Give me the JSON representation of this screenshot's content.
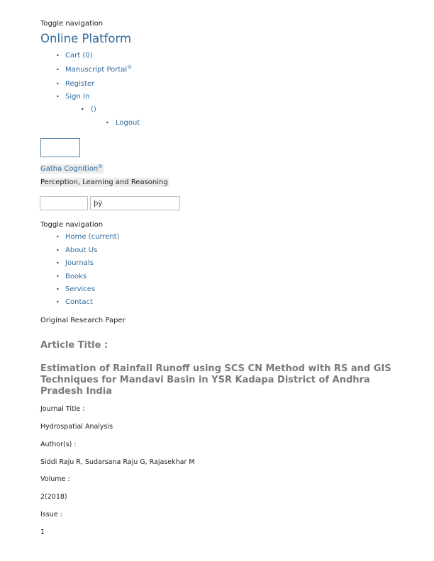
{
  "top_nav": {
    "toggle_label": "Toggle navigation",
    "brand": "Online Platform",
    "items": [
      {
        "label": "Cart (0)"
      },
      {
        "label": "Manuscript Portal",
        "sup": "®"
      },
      {
        "label": "Register"
      },
      {
        "label": "Sign In"
      }
    ],
    "sub_item": "()",
    "sub_sub_item": "Logout"
  },
  "publisher": {
    "logo_icon": "logo-image-placeholder",
    "name": "Gatha Cognition",
    "name_sup": "®",
    "tagline": "Perception, Learning and Reasoning"
  },
  "search": {
    "field1_value": "",
    "field2_value": "þÿ"
  },
  "main_nav": {
    "toggle_label": "Toggle navigation",
    "items": [
      {
        "label": "Home (current)"
      },
      {
        "label": "About Us"
      },
      {
        "label": "Journals"
      },
      {
        "label": "Books"
      },
      {
        "label": "Services"
      },
      {
        "label": "Contact"
      }
    ]
  },
  "article": {
    "type": "Original Research Paper",
    "title_label": "Article Title :",
    "title": "Estimation of Rainfall Runoff using SCS CN Method with RS and GIS Techniques for Mandavi Basin in YSR Kadapa District of Andhra Pradesh India",
    "journal_label": "Journal Title :",
    "journal": "Hydrospatial Analysis",
    "authors_label": "Author(s) :",
    "authors": "Siddi Raju R, Sudarsana Raju G, Rajasekhar M",
    "volume_label": "Volume :",
    "volume": "2(2018)",
    "issue_label": "Issue :",
    "issue": "1"
  },
  "colors": {
    "link": "#2f6a9c",
    "heading_gray": "#7a7a7a",
    "highlight_bg": "#ececec"
  }
}
